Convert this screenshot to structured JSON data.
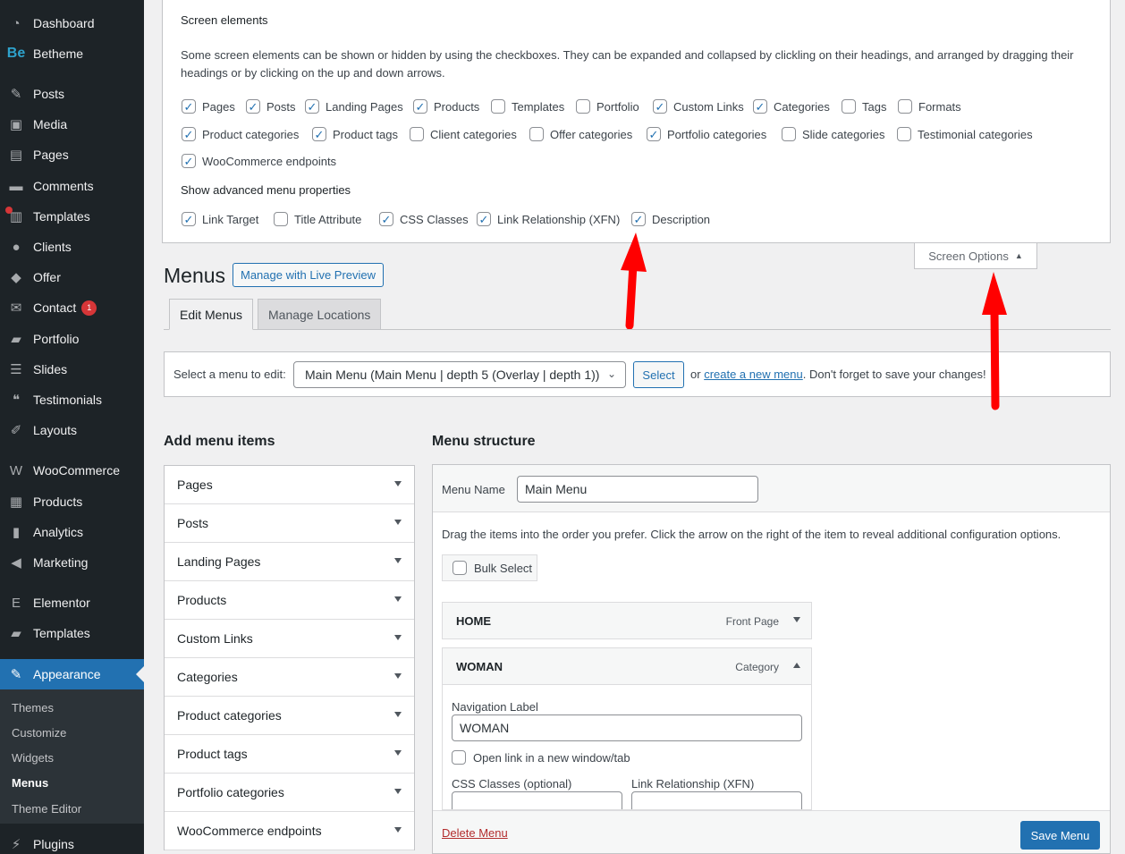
{
  "sidebar": {
    "items": [
      {
        "label": "Dashboard",
        "icon": "dashboard-icon",
        "glyph": "◔"
      },
      {
        "label": "Betheme",
        "icon": "betheme-logo-icon",
        "glyph": "Be"
      },
      {
        "label": "Posts",
        "icon": "pin-icon",
        "glyph": "✎"
      },
      {
        "label": "Media",
        "icon": "media-icon",
        "glyph": "▣"
      },
      {
        "label": "Pages",
        "icon": "pages-icon",
        "glyph": "▤"
      },
      {
        "label": "Comments",
        "icon": "comment-icon",
        "glyph": "▬"
      },
      {
        "label": "Templates",
        "icon": "templates-icon",
        "glyph": "▥"
      },
      {
        "label": "Clients",
        "icon": "clients-icon",
        "glyph": "●"
      },
      {
        "label": "Offer",
        "icon": "tag-icon",
        "glyph": "◆"
      },
      {
        "label": "Contact",
        "icon": "envelope-icon",
        "glyph": "✉",
        "badge": "1"
      },
      {
        "label": "Portfolio",
        "icon": "folder-icon",
        "glyph": "▰"
      },
      {
        "label": "Slides",
        "icon": "slides-icon",
        "glyph": "☰"
      },
      {
        "label": "Testimonials",
        "icon": "quote-icon",
        "glyph": "❝"
      },
      {
        "label": "Layouts",
        "icon": "pencil-icon",
        "glyph": "✐"
      },
      {
        "label": "WooCommerce",
        "icon": "woocommerce-icon",
        "glyph": "W"
      },
      {
        "label": "Products",
        "icon": "archive-icon",
        "glyph": "▦"
      },
      {
        "label": "Analytics",
        "icon": "bar-chart-icon",
        "glyph": "▮"
      },
      {
        "label": "Marketing",
        "icon": "megaphone-icon",
        "glyph": "◀"
      },
      {
        "label": "Elementor",
        "icon": "elementor-icon",
        "glyph": "E"
      },
      {
        "label": "Templates",
        "icon": "folder-open-icon",
        "glyph": "▰"
      },
      {
        "label": "Appearance",
        "icon": "paintbrush-icon",
        "glyph": "✎"
      },
      {
        "label": "Plugins",
        "icon": "plugin-icon",
        "glyph": "⚡"
      }
    ],
    "submenu": [
      "Themes",
      "Customize",
      "Widgets",
      "Menus",
      "Theme Editor"
    ]
  },
  "screen_options": {
    "title": "Screen elements",
    "description": "Some screen elements can be shown or hidden by using the checkboxes. They can be expanded and collapsed by clickling on their headings, and arranged by dragging their headings or by clicking on the up and down arrows.",
    "boxes": [
      {
        "label": "Pages",
        "checked": true
      },
      {
        "label": "Posts",
        "checked": true
      },
      {
        "label": "Landing Pages",
        "checked": true
      },
      {
        "label": "Products",
        "checked": true
      },
      {
        "label": "Templates",
        "checked": false
      },
      {
        "label": "Portfolio",
        "checked": false
      },
      {
        "label": "Custom Links",
        "checked": true
      },
      {
        "label": "Categories",
        "checked": true
      },
      {
        "label": "Tags",
        "checked": false
      },
      {
        "label": "Formats",
        "checked": false
      },
      {
        "label": "Product categories",
        "checked": true
      },
      {
        "label": "Product tags",
        "checked": true
      },
      {
        "label": "Client categories",
        "checked": false
      },
      {
        "label": "Offer categories",
        "checked": false
      },
      {
        "label": "Portfolio categories",
        "checked": true
      },
      {
        "label": "Slide categories",
        "checked": false
      },
      {
        "label": "Testimonial categories",
        "checked": false
      },
      {
        "label": "WooCommerce endpoints",
        "checked": true
      }
    ],
    "advanced_title": "Show advanced menu properties",
    "advanced": [
      {
        "label": "Link Target",
        "checked": true
      },
      {
        "label": "Title Attribute",
        "checked": false
      },
      {
        "label": "CSS Classes",
        "checked": true
      },
      {
        "label": "Link Relationship (XFN)",
        "checked": true
      },
      {
        "label": "Description",
        "checked": true
      }
    ],
    "tab_label": "Screen Options"
  },
  "header": {
    "title": "Menus",
    "live_preview": "Manage with Live Preview"
  },
  "tabs": [
    {
      "label": "Edit Menus",
      "active": true
    },
    {
      "label": "Manage Locations",
      "active": false
    }
  ],
  "select_bar": {
    "label": "Select a menu to edit:",
    "selected": "Main Menu (Main Menu | depth 5 (Overlay | depth 1))",
    "button": "Select",
    "or_text": "or",
    "create_link": "create a new menu",
    "after_text": ". Don't forget to save your changes!"
  },
  "add_items": {
    "heading": "Add menu items",
    "sections": [
      "Pages",
      "Posts",
      "Landing Pages",
      "Products",
      "Custom Links",
      "Categories",
      "Product categories",
      "Product tags",
      "Portfolio categories",
      "WooCommerce endpoints"
    ]
  },
  "structure": {
    "heading": "Menu structure",
    "name_label": "Menu Name",
    "name_value": "Main Menu",
    "drag_text": "Drag the items into the order you prefer. Click the arrow on the right of the item to reveal additional configuration options.",
    "bulk_select": "Bulk Select",
    "items": [
      {
        "title": "HOME",
        "type": "Front Page",
        "expanded": false
      },
      {
        "title": "WOMAN",
        "type": "Category",
        "expanded": true
      }
    ],
    "settings": {
      "nav_label": "Navigation Label",
      "nav_value": "WOMAN",
      "new_tab": "Open link in a new window/tab",
      "css_label": "CSS Classes (optional)",
      "xfn_label": "Link Relationship (XFN)"
    },
    "delete": "Delete Menu",
    "save": "Save Menu"
  },
  "colors": {
    "sidebar_bg": "#1d2327",
    "accent": "#2271b1",
    "annotation": "#ff0000"
  }
}
